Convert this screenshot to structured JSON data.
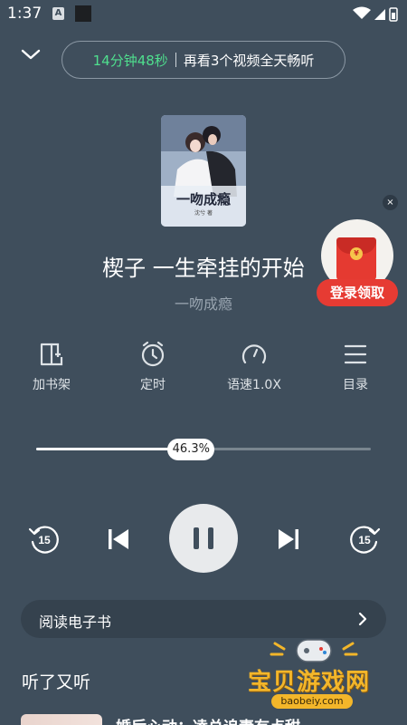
{
  "status_bar": {
    "time": "1:37",
    "notif_letter": "A"
  },
  "top": {
    "timer_remaining": "14分钟48秒",
    "timer_promo": "再看3个视频全天畅听"
  },
  "book": {
    "cover_title": "一吻成瘾",
    "cover_subtitle": "沈兮 著",
    "chapter_title": "楔子 一生牵挂的开始",
    "book_name": "一吻成瘾"
  },
  "red_packet": {
    "label": "登录领取",
    "close": "×",
    "coin": "¥"
  },
  "tools": [
    {
      "label": "加书架",
      "icon": "add-bookshelf-icon"
    },
    {
      "label": "定时",
      "icon": "alarm-clock-icon"
    },
    {
      "label": "语速1.0X",
      "icon": "speed-gauge-icon"
    },
    {
      "label": "目录",
      "icon": "menu-list-icon"
    }
  ],
  "progress": {
    "label": "46.3%",
    "fraction": 0.463
  },
  "controls": {
    "rewind": "15",
    "forward": "15"
  },
  "ebook": {
    "label": "阅读电子书"
  },
  "recommend": {
    "section_title": "听了又听",
    "first_item_title": "婚后心动：凌总追妻有点甜"
  },
  "watermark": {
    "title": "宝贝游戏网",
    "url": "baobeiy.com"
  },
  "colors": {
    "background": "#3f4e5c",
    "accent_green": "#4fdf8e",
    "red": "#e63b33"
  }
}
